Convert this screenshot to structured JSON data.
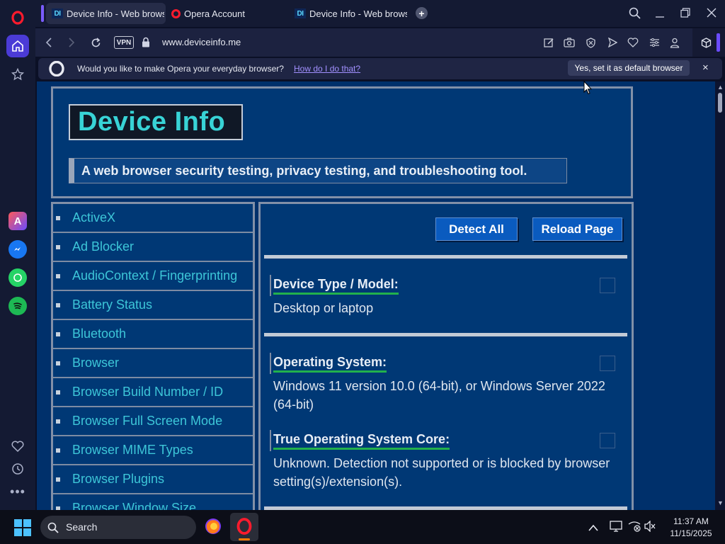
{
  "browser": {
    "tabs": [
      {
        "title": "Device Info - Web browser security testing",
        "active": true
      },
      {
        "title": "Opera Account",
        "active": false
      },
      {
        "title": "Device Info - Web browser security testing",
        "active": false
      }
    ],
    "address": "www.deviceinfo.me",
    "vpn_label": "VPN"
  },
  "banner": {
    "message": "Would you like to make Opera your everyday browser?",
    "link": "How do I do that?",
    "button": "Yes, set it as default browser",
    "close": "×"
  },
  "page": {
    "logo": "Device Info",
    "tagline": "A web browser security testing, privacy testing, and troubleshooting tool.",
    "nav_items": [
      "ActiveX",
      "Ad Blocker",
      "AudioContext / Fingerprinting",
      "Battery Status",
      "Bluetooth",
      "Browser",
      "Browser Build Number / ID",
      "Browser Full Screen Mode",
      "Browser MIME Types",
      "Browser Plugins",
      "Browser Window Size"
    ],
    "buttons": {
      "detect_all": "Detect All",
      "reload": "Reload Page"
    },
    "sections": [
      {
        "title": "Device Type / Model:",
        "value": "Desktop or laptop"
      },
      {
        "title": "Operating System:",
        "value": "Windows 11 version 10.0 (64-bit), or Windows Server 2022 (64-bit)"
      },
      {
        "title": "True Operating System Core:",
        "value": "Unknown. Detection not supported or is blocked by browser setting(s)/extension(s)."
      }
    ]
  },
  "taskbar": {
    "search_placeholder": "Search",
    "time": "11:37 AM",
    "date": "11/15/2025"
  },
  "colors": {
    "page_bg": "#00306b",
    "link": "#3dc6d8",
    "accent_green": "#22b14c",
    "opera_red": "#ff1b2d"
  }
}
